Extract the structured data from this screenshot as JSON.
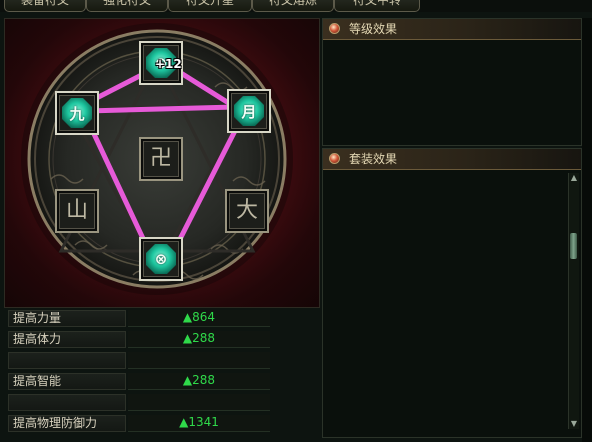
{
  "tabs": [
    {
      "label": "装备符文"
    },
    {
      "label": "强化符文"
    },
    {
      "label": "符文升星"
    },
    {
      "label": "符文熔炼"
    },
    {
      "label": "符文中转"
    }
  ],
  "rune_circle": {
    "badge": "+12",
    "slots": {
      "top": {
        "glyph": "⊕",
        "active": true
      },
      "left": {
        "glyph": "九",
        "active": true
      },
      "right": {
        "glyph": "月",
        "active": true
      },
      "center": {
        "glyph": "卍",
        "active": false
      },
      "bottom_left": {
        "glyph": "山",
        "active": false
      },
      "bottom_right": {
        "glyph": "大",
        "active": false
      },
      "bottom": {
        "glyph": "⊗",
        "active": true
      }
    }
  },
  "stats": [
    {
      "label": "提高力量",
      "value": "▲864"
    },
    {
      "label": "提高体力",
      "value": "▲288"
    },
    {
      "label": "",
      "value": ""
    },
    {
      "label": "提高智能",
      "value": "▲288"
    },
    {
      "label": "",
      "value": ""
    },
    {
      "label": "提高物理防御力",
      "value": "▲1341"
    }
  ],
  "level_effect": {
    "title": "等级效果"
  },
  "set_effect": {
    "title": "套装效果"
  },
  "colors": {
    "link": "#e65ad8",
    "gem": "#1ec7a0",
    "stat_value": "#2fd94a"
  }
}
